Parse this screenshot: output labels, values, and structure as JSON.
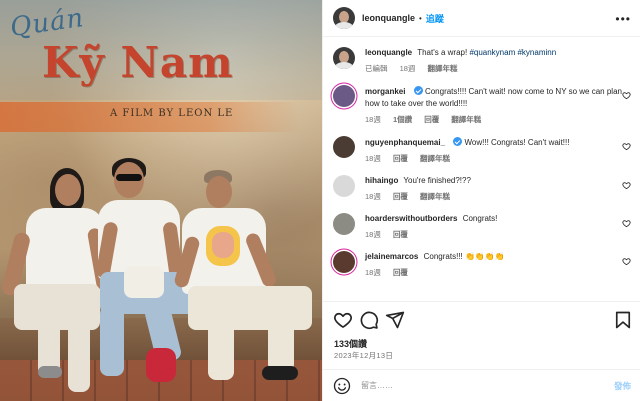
{
  "photo": {
    "sign_top": "Quán",
    "sign_main": "Kỹ Nam",
    "sign_credit": "A FILM BY LEON LE"
  },
  "post": {
    "username": "leonquangle",
    "follow_label": "追蹤",
    "more_icon": "more-horizontal-icon",
    "caption": {
      "username": "leonquangle",
      "text": "That's a wrap!",
      "hashtags": "#quankynam #kynaminn",
      "meta_edited": "已編輯",
      "time": "18週",
      "translate": "翻譯年糕"
    },
    "comments": [
      {
        "username": "morgankei",
        "verified": true,
        "text": "Congrats!!!! Can't wait! now come to NY so we can plan how to take over the world!!!!",
        "time": "18週",
        "likes": "1個讚",
        "reply": "回覆",
        "translate": "翻譯年糕",
        "avatar_color": "#6b5a86"
      },
      {
        "username": "nguyenphanquemai_",
        "verified": true,
        "text": "Wow!!! Congrats! Can't wait!!!",
        "time": "18週",
        "likes": "",
        "reply": "回覆",
        "translate": "翻譯年糕",
        "avatar_color": "#4a3c33"
      },
      {
        "username": "hihaingo",
        "verified": false,
        "text": "You're finished?!??",
        "time": "18週",
        "likes": "",
        "reply": "回覆",
        "translate": "翻譯年糕",
        "avatar_color": "#d9d9d9"
      },
      {
        "username": "hoarderswithoutborders",
        "verified": false,
        "text": "Congrats!",
        "time": "18週",
        "likes": "",
        "reply": "回覆",
        "translate": "",
        "avatar_color": "#8c8c84"
      },
      {
        "username": "jelainemarcos",
        "verified": false,
        "text": "Congrats!!! 👏👏👏👏",
        "time": "18週",
        "likes": "",
        "reply": "回覆",
        "translate": "",
        "avatar_color": "#5a3a2e"
      }
    ],
    "likes_count": "133個讚",
    "date": "2023年12月13日",
    "comment_placeholder": "留言……",
    "post_button": "發佈"
  }
}
